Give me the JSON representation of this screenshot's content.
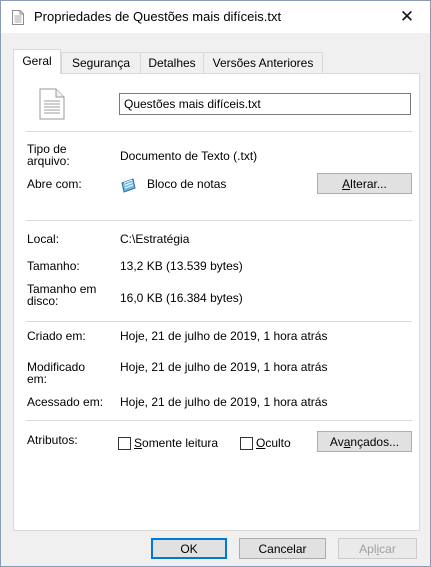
{
  "window": {
    "title": "Propriedades de Questões mais difíceis.txt",
    "close_glyph": "✕"
  },
  "tabs": [
    {
      "label": "Geral",
      "active": true
    },
    {
      "label": "Segurança",
      "active": false
    },
    {
      "label": "Detalhes",
      "active": false
    },
    {
      "label": "Versões Anteriores",
      "active": false
    }
  ],
  "general": {
    "filename": "Questões mais difíceis.txt",
    "file_type_label": "Tipo de arquivo:",
    "file_type_value": "Documento de Texto (.txt)",
    "opens_with_label": "Abre com:",
    "opens_with_value": "Bloco de notas",
    "change_button": {
      "underlined": "A",
      "rest": "lterar..."
    },
    "location_label": "Local:",
    "location_value": "C:\\Estratégia",
    "size_label": "Tamanho:",
    "size_value": "13,2 KB (13.539 bytes)",
    "size_on_disk_label": "Tamanho em disco:",
    "size_on_disk_value": "16,0 KB (16.384 bytes)",
    "created_label": "Criado em:",
    "created_value": "Hoje, 21 de julho de 2019, 1 hora atrás",
    "modified_label": "Modificado em:",
    "modified_value": "Hoje, 21 de julho de 2019, 1 hora atrás",
    "accessed_label": "Acessado em:",
    "accessed_value": "Hoje, 21 de julho de 2019, 1 hora atrás",
    "attributes_label": "Atributos:",
    "readonly": {
      "underlined": "S",
      "rest": "omente leitura",
      "checked": false
    },
    "hidden": {
      "underlined": "O",
      "rest": "culto",
      "checked": false
    },
    "advanced_button": {
      "before": "Av",
      "underlined": "a",
      "after": "nçados..."
    }
  },
  "footer": {
    "ok": "OK",
    "cancel": "Cancelar",
    "apply": {
      "before": "Apl",
      "underlined": "i",
      "after": "car"
    }
  },
  "colors": {
    "accent": "#0078d7",
    "separator": "#d9d9d9",
    "window_bg": "#f0f0f0"
  },
  "icons": {
    "title": "text-document-icon",
    "file": "text-document-icon",
    "app": "notepad-icon"
  }
}
